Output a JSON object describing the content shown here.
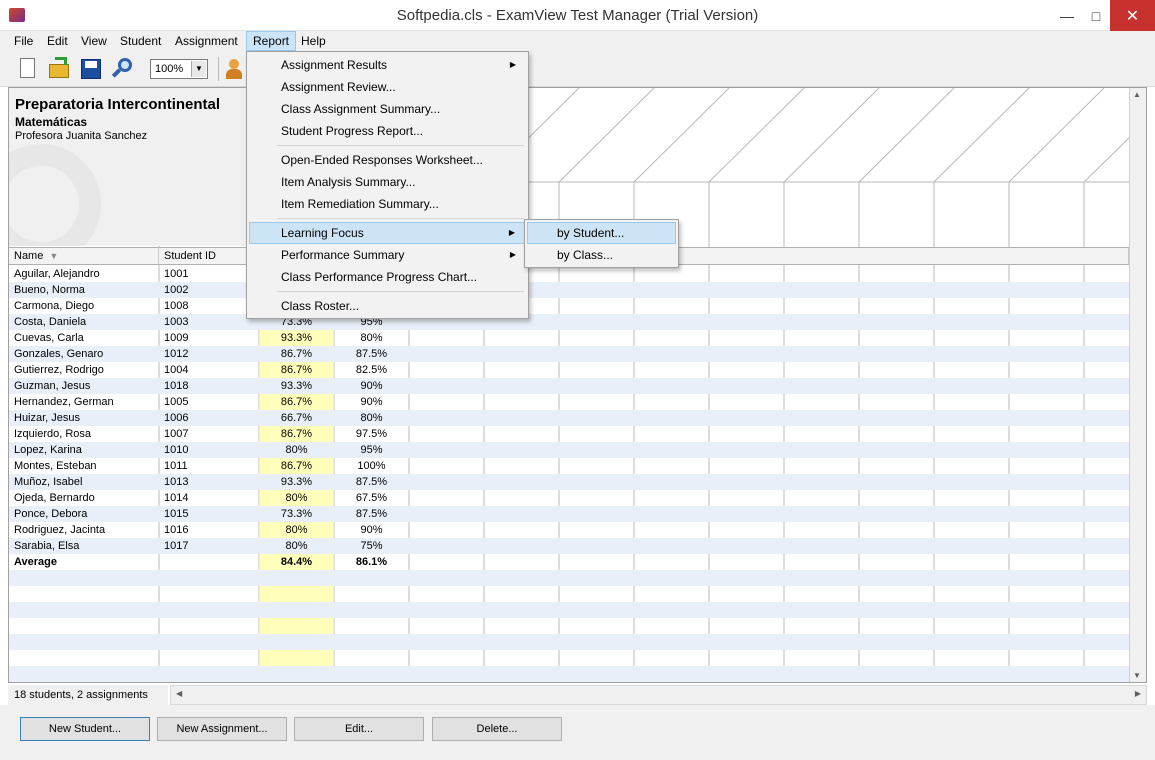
{
  "window": {
    "title": "Softpedia.cls - ExamView Test Manager (Trial Version)"
  },
  "menubar": {
    "items": [
      {
        "label": "File"
      },
      {
        "label": "Edit"
      },
      {
        "label": "View"
      },
      {
        "label": "Student"
      },
      {
        "label": "Assignment"
      },
      {
        "label": "Report"
      },
      {
        "label": "Help"
      }
    ]
  },
  "toolbar": {
    "zoom": "100%"
  },
  "school": {
    "name": "Preparatoria Intercontinental",
    "subject": "Matemáticas",
    "teacher": "Profesora Juanita Sanchez"
  },
  "table": {
    "headers": {
      "name": "Name",
      "student_id": "Student ID"
    },
    "rows": [
      {
        "name": "Aguilar, Alejandro",
        "id": "1001",
        "a1": "",
        "a2": ""
      },
      {
        "name": "Bueno, Norma",
        "id": "1002",
        "a1": "",
        "a2": ""
      },
      {
        "name": "Carmona, Diego",
        "id": "1008",
        "a1": "",
        "a2": ""
      },
      {
        "name": "Costa, Daniela",
        "id": "1003",
        "a1": "73.3%",
        "a2": "95%"
      },
      {
        "name": "Cuevas, Carla",
        "id": "1009",
        "a1": "93.3%",
        "a2": "80%"
      },
      {
        "name": "Gonzales, Genaro",
        "id": "1012",
        "a1": "86.7%",
        "a2": "87.5%"
      },
      {
        "name": "Gutierrez, Rodrigo",
        "id": "1004",
        "a1": "86.7%",
        "a2": "82.5%"
      },
      {
        "name": "Guzman, Jesus",
        "id": "1018",
        "a1": "93.3%",
        "a2": "90%"
      },
      {
        "name": "Hernandez, German",
        "id": "1005",
        "a1": "86.7%",
        "a2": "90%"
      },
      {
        "name": "Huizar, Jesus",
        "id": "1006",
        "a1": "66.7%",
        "a2": "80%"
      },
      {
        "name": "Izquierdo, Rosa",
        "id": "1007",
        "a1": "86.7%",
        "a2": "97.5%"
      },
      {
        "name": "Lopez, Karina",
        "id": "1010",
        "a1": "80%",
        "a2": "95%"
      },
      {
        "name": "Montes, Esteban",
        "id": "1011",
        "a1": "86.7%",
        "a2": "100%"
      },
      {
        "name": "Muñoz, Isabel",
        "id": "1013",
        "a1": "93.3%",
        "a2": "87.5%"
      },
      {
        "name": "Ojeda, Bernardo",
        "id": "1014",
        "a1": "80%",
        "a2": "67.5%"
      },
      {
        "name": "Ponce, Debora",
        "id": "1015",
        "a1": "73.3%",
        "a2": "87.5%"
      },
      {
        "name": "Rodriguez, Jacinta",
        "id": "1016",
        "a1": "80%",
        "a2": "90%"
      },
      {
        "name": "Sarabia, Elsa",
        "id": "1017",
        "a1": "80%",
        "a2": "75%"
      }
    ],
    "average": {
      "label": "Average",
      "a1": "84.4%",
      "a2": "86.1%"
    }
  },
  "status": {
    "text": "18 students, 2 assignments"
  },
  "buttons": {
    "new_student": "New Student...",
    "new_assignment": "New Assignment...",
    "edit": "Edit...",
    "delete": "Delete..."
  },
  "report_menu": {
    "items": [
      {
        "label": "Assignment Results"
      },
      {
        "label": "Assignment Review..."
      },
      {
        "label": "Class Assignment Summary..."
      },
      {
        "label": "Student Progress Report..."
      },
      {
        "label": "Open-Ended Responses Worksheet..."
      },
      {
        "label": "Item Analysis Summary..."
      },
      {
        "label": "Item Remediation Summary..."
      },
      {
        "label": "Learning Focus"
      },
      {
        "label": "Performance Summary"
      },
      {
        "label": "Class Performance Progress Chart..."
      },
      {
        "label": "Class Roster..."
      }
    ],
    "learning_focus_submenu": [
      {
        "label": "by Student..."
      },
      {
        "label": "by Class..."
      }
    ]
  }
}
